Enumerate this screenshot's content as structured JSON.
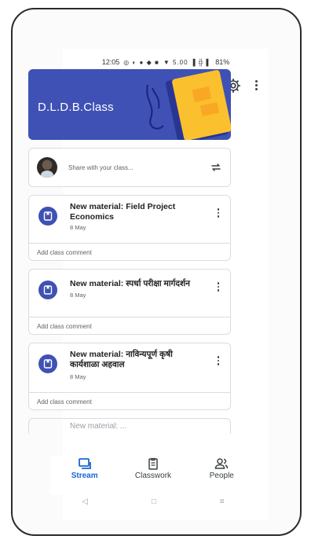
{
  "status_bar": {
    "time": "12:05",
    "icons_left": "◎ ◐ ● ◆ ■",
    "indicators": "▼ 5.00 ▐ ╬ ▌",
    "battery": "81%"
  },
  "app_bar": {
    "menu_icon": "menu-icon",
    "settings_icon": "gear-icon",
    "more_icon": "more-vert-icon"
  },
  "banner": {
    "class_name": "D.L.D.B.Class",
    "colors": {
      "background": "#3f51b5",
      "accent": "#fbc02d"
    }
  },
  "share": {
    "placeholder": "Share with your class...",
    "repost_icon": "repost-icon"
  },
  "posts": [
    {
      "title": "New material: Field Project Economics",
      "date": "8 May",
      "comment": "Add class comment"
    },
    {
      "title": "New material: स्पर्धा परीक्षा मार्गदर्शन",
      "date": "8 May",
      "comment": "Add class comment"
    },
    {
      "title": "New material: नाविन्यपूर्ण कृषी कार्यशाळा अहवाल",
      "date": "8 May",
      "comment": "Add class comment"
    }
  ],
  "peek_post": {
    "title": "New material: ..."
  },
  "bottom_nav": {
    "items": [
      {
        "label": "Stream",
        "icon": "stream-icon",
        "active": true
      },
      {
        "label": "Classwork",
        "icon": "classwork-icon",
        "active": false
      },
      {
        "label": "People",
        "icon": "people-icon",
        "active": false
      }
    ],
    "active_color": "#1967d2"
  },
  "system_nav": {
    "back": "◁",
    "home": "□",
    "recents": "≡"
  }
}
